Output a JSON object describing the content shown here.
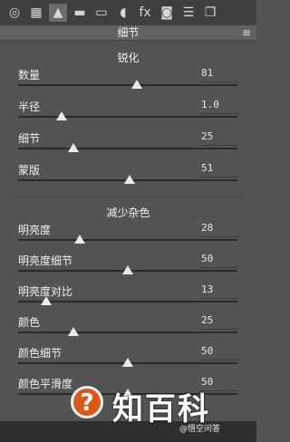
{
  "toolbar": {
    "icons": [
      {
        "name": "basic-icon",
        "glyph": "◎"
      },
      {
        "name": "tone-curve-icon",
        "glyph": "▦"
      },
      {
        "name": "detail-icon",
        "glyph": "▲"
      },
      {
        "name": "hsl-icon",
        "glyph": "▬"
      },
      {
        "name": "split-toning-icon",
        "glyph": "▭"
      },
      {
        "name": "lens-corrections-icon",
        "glyph": "◖"
      },
      {
        "name": "effects-icon",
        "glyph": "fx"
      },
      {
        "name": "camera-calibration-icon",
        "glyph": "◙"
      },
      {
        "name": "presets-icon",
        "glyph": "☰"
      },
      {
        "name": "snapshots-icon",
        "glyph": "❐"
      }
    ]
  },
  "header": {
    "title": "细节",
    "menu_glyph": "≡"
  },
  "sharpening": {
    "title": "锐化",
    "sliders": [
      {
        "label": "数量",
        "value": "81",
        "level": 0.54
      },
      {
        "label": "半径",
        "value": "1.0",
        "level": 0.2
      },
      {
        "label": "细节",
        "value": "25",
        "level": 0.25
      },
      {
        "label": "蒙版",
        "value": "51",
        "level": 0.51
      }
    ]
  },
  "noise": {
    "title": "减少杂色",
    "sliders": [
      {
        "label": "明亮度",
        "value": "28",
        "level": 0.28
      },
      {
        "label": "明亮度细节",
        "value": "50",
        "level": 0.5
      },
      {
        "label": "明亮度对比",
        "value": "13",
        "level": 0.13
      },
      {
        "label": "颜色",
        "value": "25",
        "level": 0.25
      },
      {
        "label": "颜色细节",
        "value": "50",
        "level": 0.5
      },
      {
        "label": "颜色平滑度",
        "value": "50",
        "level": 0.5
      }
    ]
  },
  "watermark": {
    "symbol": "?",
    "brand": "知百科",
    "sub": "@悟空问答"
  }
}
